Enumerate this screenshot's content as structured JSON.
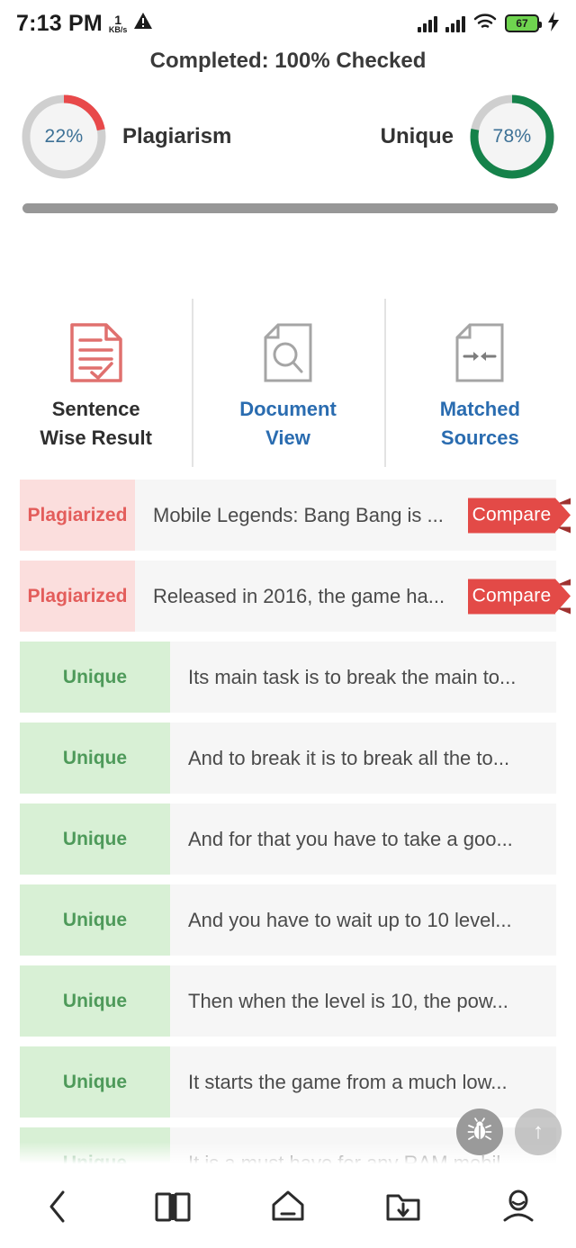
{
  "statusbar": {
    "time": "7:13 PM",
    "network_rate_value": "1",
    "network_rate_unit": "KB/s",
    "battery_percent": "67"
  },
  "header": {
    "completed_text": "Completed: 100% Checked"
  },
  "gauges": [
    {
      "name": "plagiarism",
      "value": "22%",
      "percent": 22,
      "label": "Plagiarism",
      "color": "#e8494a",
      "track": "#cfcfcf"
    },
    {
      "name": "unique",
      "value": "78%",
      "percent": 78,
      "label": "Unique",
      "color": "#15824a",
      "track": "#cfcfcf"
    }
  ],
  "tabs": [
    {
      "label_line1": "Sentence",
      "label_line2": "Wise Result",
      "icon": "document-check-icon",
      "active": true,
      "color": "#2e2e2e"
    },
    {
      "label_line1": "Document",
      "label_line2": "View",
      "icon": "document-search-icon",
      "active": false,
      "color": "#2a6cb0"
    },
    {
      "label_line1": "Matched",
      "label_line2": "Sources",
      "icon": "document-compare-icon",
      "active": false,
      "color": "#2a6cb0"
    }
  ],
  "results": {
    "compare_label": "Compare",
    "rows": [
      {
        "status": "Plagiarized",
        "type": "plagiarized",
        "text": "Mobile Legends: Bang Bang is ...",
        "has_compare": true
      },
      {
        "status": "Plagiarized",
        "type": "plagiarized",
        "text": "Released in 2016, the game ha...",
        "has_compare": true
      },
      {
        "status": "Unique",
        "type": "unique",
        "text": "Its main task is to break the main to...",
        "has_compare": false
      },
      {
        "status": "Unique",
        "type": "unique",
        "text": "And to break it is to break all the to...",
        "has_compare": false
      },
      {
        "status": "Unique",
        "type": "unique",
        "text": "And for that you have to take a goo...",
        "has_compare": false
      },
      {
        "status": "Unique",
        "type": "unique",
        "text": "And you have to wait up to 10 level...",
        "has_compare": false
      },
      {
        "status": "Unique",
        "type": "unique",
        "text": "Then when the level is 10, the pow...",
        "has_compare": false
      },
      {
        "status": "Unique",
        "type": "unique",
        "text": "It starts the game from a much low...",
        "has_compare": false
      },
      {
        "status": "Unique",
        "type": "unique",
        "text": "It is a must have for any RAM mobil",
        "has_compare": false
      }
    ]
  },
  "floating": {
    "bug_icon": "bug-icon",
    "scroll_top_icon": "arrow-up-icon",
    "scroll_top_glyph": "↑"
  },
  "bottomnav": [
    {
      "name": "back",
      "icon": "chevron-left-icon"
    },
    {
      "name": "library",
      "icon": "open-book-icon"
    },
    {
      "name": "home",
      "icon": "home-icon"
    },
    {
      "name": "downloads",
      "icon": "folder-download-icon"
    },
    {
      "name": "profile",
      "icon": "person-icon"
    }
  ],
  "colors": {
    "plagiarism_red": "#e34a47",
    "unique_green": "#4e9a5a",
    "link_blue": "#2a6cb0",
    "tag_red_bg": "#fbdedd",
    "tag_green_bg": "#d8f0d5"
  }
}
